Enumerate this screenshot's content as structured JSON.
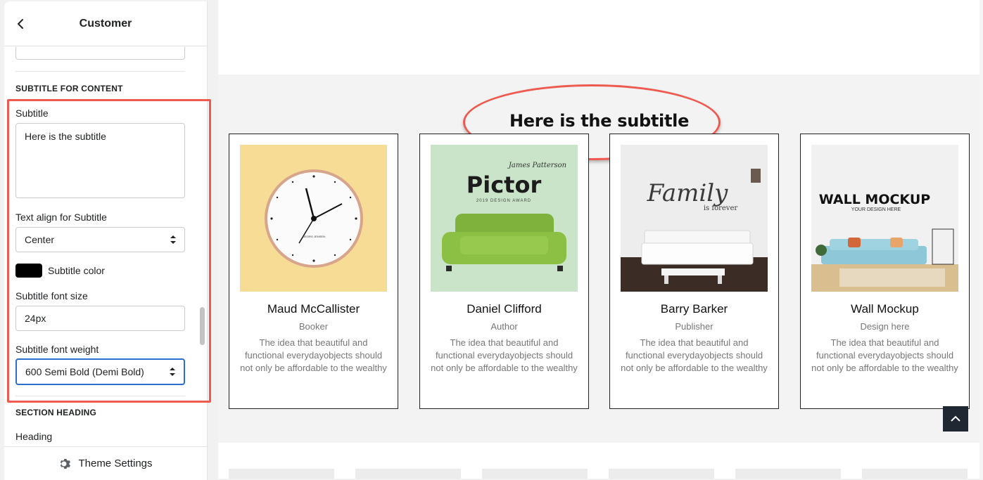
{
  "sidebar": {
    "title": "Customer",
    "section1_heading": "SUBTITLE FOR CONTENT",
    "subtitle_label": "Subtitle",
    "subtitle_value": "Here is the subtitle",
    "text_align_label": "Text align for Subtitle",
    "text_align_value": "Center",
    "color_label": "Subtitle color",
    "color_value": "#000000",
    "font_size_label": "Subtitle font size",
    "font_size_value": "24px",
    "font_weight_label": "Subtitle font weight",
    "font_weight_value": "600 Semi Bold (Demi Bold)",
    "section2_heading": "SECTION HEADING",
    "heading_label": "Heading",
    "footer_label": "Theme Settings"
  },
  "preview": {
    "subtitle": "Here is the subtitle",
    "cards": [
      {
        "name": "Maud McCallister",
        "role": "Booker",
        "desc": "The idea that beautiful and functional everydayobjects should not only be affordable to the wealthy"
      },
      {
        "name": "Daniel Clifford",
        "role": "Author",
        "desc": "The idea that beautiful and functional everydayobjects should not only be affordable to the wealthy"
      },
      {
        "name": "Barry Barker",
        "role": "Publisher",
        "desc": "The idea that beautiful and functional everydayobjects should not only be affordable to the wealthy"
      },
      {
        "name": "Wall Mockup",
        "role": "Design here",
        "desc": "The idea that beautiful and functional everydayobjects should not only be affordable to the wealthy"
      }
    ],
    "img2": {
      "script": "James Patterson",
      "title": "Pictor",
      "award": "2019 DESIGN AWARD"
    },
    "img3": {
      "title": "Family",
      "sub": "is forever"
    },
    "img4": {
      "title": "WALL MOCKUP",
      "sub": "YOUR DESIGN HERE"
    },
    "clock_brand": "GEORG JENSEN"
  },
  "colors": {
    "accent_annotation": "#ee5a50",
    "focus_blue": "#2c6ecb",
    "scroll_top_bg": "#1f2733"
  }
}
